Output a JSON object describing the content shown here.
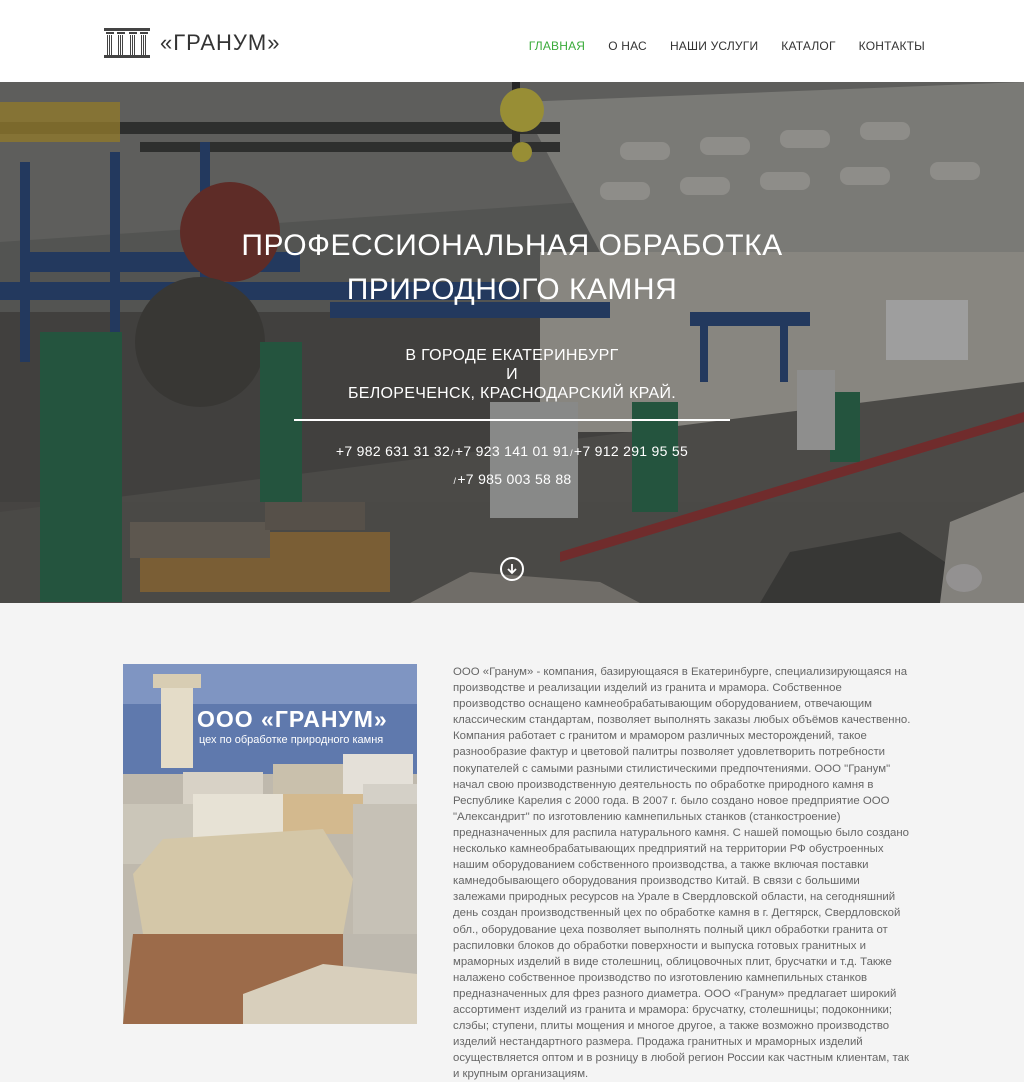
{
  "header": {
    "logo_text": "«ГРАНУМ»",
    "nav": [
      {
        "label": "ГЛАВНАЯ",
        "active": true
      },
      {
        "label": "О НАС",
        "active": false
      },
      {
        "label": "НАШИ УСЛУГИ",
        "active": false
      },
      {
        "label": "КАТАЛОГ",
        "active": false
      },
      {
        "label": "КОНТАКТЫ",
        "active": false
      }
    ]
  },
  "hero": {
    "title_line1": "ПРОФЕССИОНАЛЬНАЯ ОБРАБОТКА",
    "title_line2": "ПРИРОДНОГО КАМНЯ",
    "sub_line1": "В ГОРОДЕ ЕКАТЕРИНБУРГ",
    "sub_line2": "И",
    "sub_line3": "БЕЛОРЕЧЕНСК, КРАСНОДАРСКИЙ КРАЙ.",
    "phones": [
      "+7 982 631 31 32",
      "+7 923 141 01 91",
      "+7 912 291 95 55",
      "+7 985 003 58 88"
    ],
    "phone_sep": "/",
    "scroll_icon": "arrow-down-circle-icon"
  },
  "about": {
    "image_title": "ООО «ГРАНУМ»",
    "image_subtitle": "цех по обработке природного камня",
    "text": "ООО «Гранум» - компания, базирующаяся в Екатеринбурге, специализирующаяся на производстве и реализации изделий из гранита и мрамора. Собственное производство оснащено камнеобрабатывающим оборудованием, отвечающим классическим стандартам, позволяет выполнять заказы любых объёмов качественно. Компания работает с гранитом и мрамором различных месторождений, такое разнообразие фактур и цветовой палитры позволяет удовлетворить потребности покупателей с самыми разными стилистическими предпочтениями. ООО \"Гранум\" начал свою производственную деятельность по обработке природного камня в Республике Карелия с 2000 года. В 2007 г. было создано новое предприятие ООО \"Александрит\" по изготовлению камнепильных станков (станкостроение) предназначенных для распила натурального камня. С нашей помощью было создано несколько камнеобрабатывающих предприятий на территории РФ обустроенных нашим оборудованием собственного производства, а также включая поставки камнедобывающего оборудования производство Китай. В связи с большими залежами природных ресурсов на Урале в Свердловской области, на сегодняшний день создан производственный цех по обработке камня в г. Дегтярск, Свердловской обл., оборудование цеха позволяет выполнять полный цикл обработки гранита от распиловки блоков до обработки поверхности и выпуска готовых гранитных и мраморных изделий в виде столешниц, облицовочных плит, брусчатки и т.д. Также налажено собственное производство по изготовлению камнепильных станков предназначенных для фрез разного диаметра. ООО «Гранум» предлагает широкий ассортимент изделий из гранита и мрамора: брусчатку, столешницы; подоконники; слэбы; ступени, плиты мощения и многое другое, а также возможно производство изделий нестандартного размера. Продажа гранитных и мраморных изделий осуществляется оптом и в розницу в любой регион России как частным клиентам, так и крупным организациям."
  },
  "colors": {
    "accent": "#3aab3a",
    "header_bg": "#ffffff",
    "page_bg": "#f4f4f4"
  }
}
